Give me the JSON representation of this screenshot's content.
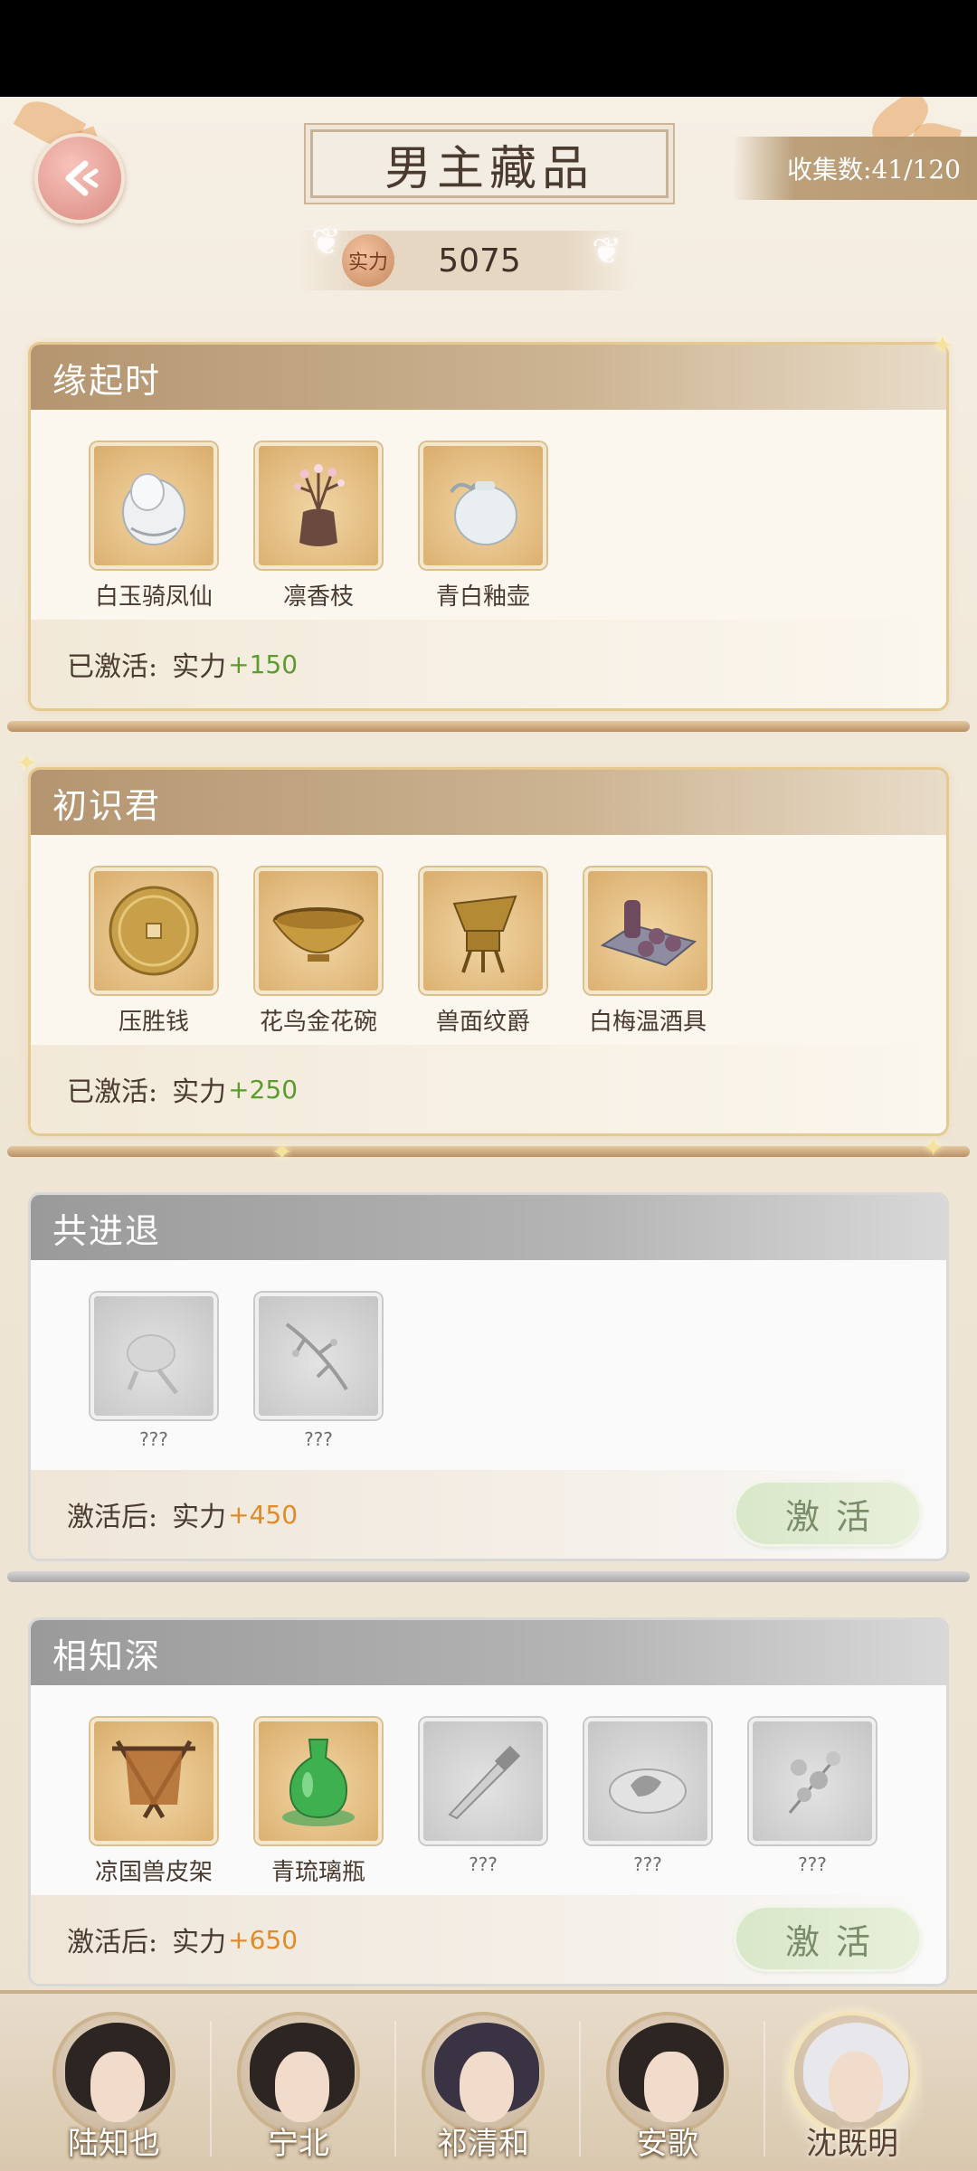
{
  "header": {
    "title": "男主藏品",
    "collect_count": "收集数:41/120",
    "power_badge": "实力",
    "power_value": "5075"
  },
  "sections": [
    {
      "title": "缘起时",
      "state": "activated",
      "items": [
        {
          "name": "白玉骑凤仙",
          "locked": false
        },
        {
          "name": "凛香枝",
          "locked": false
        },
        {
          "name": "青白釉壶",
          "locked": false
        }
      ],
      "bonus_label": "已激活:",
      "bonus_power": "实力",
      "bonus_value": "+150"
    },
    {
      "title": "初识君",
      "state": "activated",
      "items": [
        {
          "name": "压胜钱",
          "locked": false
        },
        {
          "name": "花鸟金花碗",
          "locked": false
        },
        {
          "name": "兽面纹爵",
          "locked": false
        },
        {
          "name": "白梅温酒具",
          "locked": false
        }
      ],
      "bonus_label": "已激活:",
      "bonus_power": "实力",
      "bonus_value": "+250"
    },
    {
      "title": "共进退",
      "state": "locked",
      "items": [
        {
          "name": "???",
          "locked": true
        },
        {
          "name": "???",
          "locked": true
        }
      ],
      "bonus_label": "激活后:",
      "bonus_power": "实力",
      "bonus_value": "+450",
      "activate_label": "激活"
    },
    {
      "title": "相知深",
      "state": "locked",
      "items": [
        {
          "name": "凉国兽皮架",
          "locked": false
        },
        {
          "name": "青琉璃瓶",
          "locked": false
        },
        {
          "name": "???",
          "locked": true
        },
        {
          "name": "???",
          "locked": true
        },
        {
          "name": "???",
          "locked": true
        }
      ],
      "bonus_label": "激活后:",
      "bonus_power": "实力",
      "bonus_value": "+650",
      "activate_label": "激活"
    }
  ],
  "characters": [
    {
      "name": "陆知也",
      "selected": false
    },
    {
      "name": "宁北",
      "selected": false
    },
    {
      "name": "祁清和",
      "selected": false
    },
    {
      "name": "安歌",
      "selected": false
    },
    {
      "name": "沈既明",
      "selected": true
    }
  ],
  "colors": {
    "bonus_active": "#5c9b2e",
    "bonus_pending": "#e08b28",
    "activate_button": "#d9e7c9",
    "header_active": "#b49570",
    "header_locked": "#9a9a9a"
  }
}
